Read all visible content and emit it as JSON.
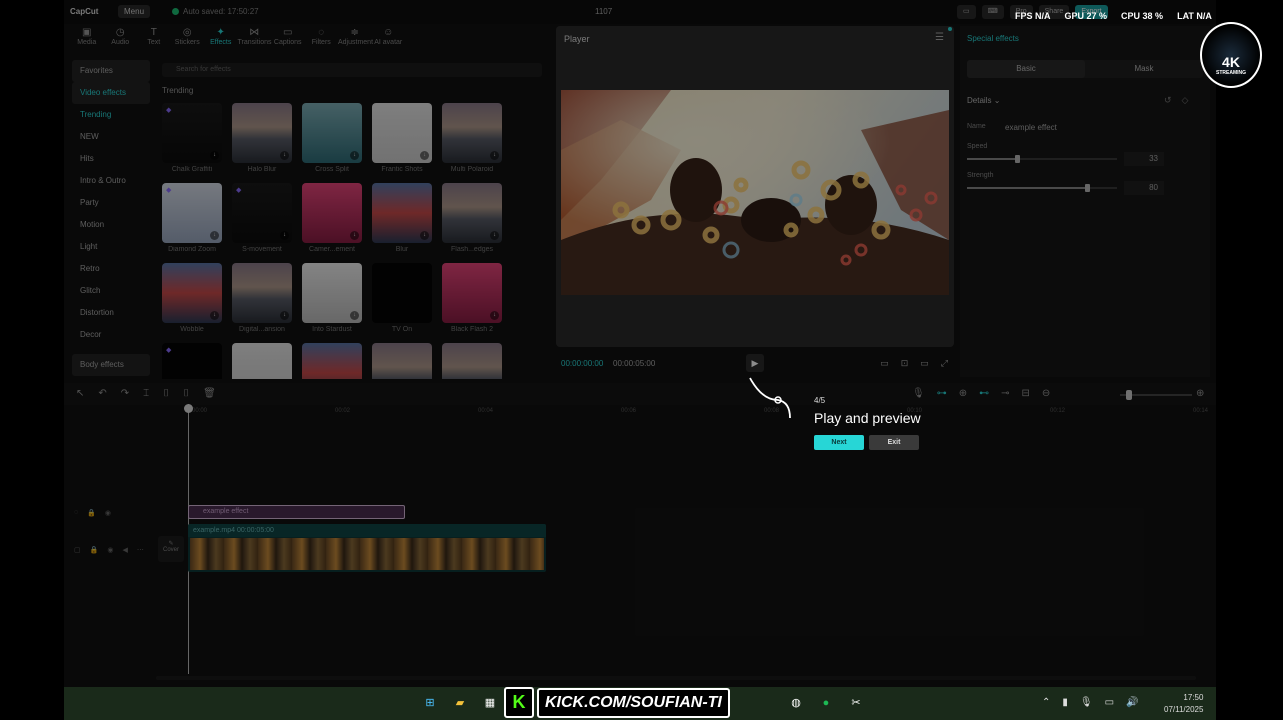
{
  "app": {
    "logo": "CapCut",
    "menu": "Menu",
    "autosave": "Auto saved: 17:50:27",
    "project": "1107",
    "top_buttons": [
      "Pro",
      "Share",
      "Export"
    ]
  },
  "tools": [
    {
      "label": "Media",
      "icon": "media-icon",
      "glyph": "▣"
    },
    {
      "label": "Audio",
      "icon": "audio-icon",
      "glyph": "◷"
    },
    {
      "label": "Text",
      "icon": "text-icon",
      "glyph": "T"
    },
    {
      "label": "Stickers",
      "icon": "stickers-icon",
      "glyph": "◎"
    },
    {
      "label": "Effects",
      "icon": "effects-icon",
      "glyph": "✦"
    },
    {
      "label": "Transitions",
      "icon": "transitions-icon",
      "glyph": "⋈"
    },
    {
      "label": "Captions",
      "icon": "captions-icon",
      "glyph": "▭"
    },
    {
      "label": "Filters",
      "icon": "filters-icon",
      "glyph": "◌"
    },
    {
      "label": "Adjustment",
      "icon": "adjustment-icon",
      "glyph": "≑"
    },
    {
      "label": "AI avatar",
      "icon": "ai-avatar-icon",
      "glyph": "☺"
    }
  ],
  "categories": [
    "Favorites",
    "Video effects",
    "Trending",
    "NEW",
    "Hits",
    "Intro & Outro",
    "Party",
    "Motion",
    "Light",
    "Retro",
    "Glitch",
    "Distortion",
    "Decor",
    "Body effects"
  ],
  "search": {
    "placeholder": "Search for effects"
  },
  "section_title": "Trending",
  "effects": [
    {
      "label": "Chalk Graffiti",
      "style": "t-dark"
    },
    {
      "label": "Halo Blur",
      "style": "t-city"
    },
    {
      "label": "Cross Split",
      "style": "t-teal"
    },
    {
      "label": "Frantic Shots",
      "style": "t-white"
    },
    {
      "label": "Multi Polaroid",
      "style": "t-city"
    },
    {
      "label": "Diamond Zoom",
      "style": "t-snow"
    },
    {
      "label": "S-movement",
      "style": "t-dark"
    },
    {
      "label": "Camer...ement",
      "style": "t-pink"
    },
    {
      "label": "Blur",
      "style": "t-red"
    },
    {
      "label": "Flash...edges",
      "style": "t-city"
    },
    {
      "label": "Wobble",
      "style": "t-red"
    },
    {
      "label": "Digital...ansion",
      "style": "t-city"
    },
    {
      "label": "Into Stardust",
      "style": "t-bw"
    },
    {
      "label": "TV On",
      "style": "t-black"
    },
    {
      "label": "Black Flash 2",
      "style": "t-pink"
    },
    {
      "label": "",
      "style": "t-black"
    },
    {
      "label": "",
      "style": "t-white"
    },
    {
      "label": "",
      "style": "t-red"
    },
    {
      "label": "",
      "style": "t-city"
    },
    {
      "label": "",
      "style": "t-city"
    }
  ],
  "player": {
    "title": "Player",
    "time_current": "00:00:00:00",
    "time_total": "00:00:05:00"
  },
  "right_panel": {
    "title": "Special effects",
    "tabs": [
      "Basic",
      "Mask"
    ],
    "details": "Details",
    "name_label": "Name",
    "name_value": "example effect",
    "speed_label": "Speed",
    "speed_value": "33",
    "strength_label": "Strength",
    "strength_value": "80"
  },
  "timeline": {
    "ruler": [
      "00:00",
      "00:02",
      "00:04",
      "00:06",
      "00:08",
      "00:10",
      "00:12",
      "00:14"
    ],
    "effect_clip": "example effect",
    "video_clip": "example.mp4  00:00:05:00",
    "cover": "Cover"
  },
  "guide": {
    "step": "4/5",
    "title": "Play and preview",
    "next": "Next",
    "exit": "Exit"
  },
  "stats": {
    "fps": "FPS N/A",
    "gpu": "GPU 27 %",
    "cpu": "CPU 38 %",
    "lat": "LAT N/A"
  },
  "badge": {
    "big": "4K",
    "small": "STREAMING"
  },
  "taskbar": {
    "kick_url": "KICK.COM/SOUFIAN-TI",
    "time": "17:50",
    "date": "07/11/2025"
  },
  "colors": {
    "accent": "#2bd6d6",
    "effect_clip": "#4b2f50",
    "video_clip": "#0d3a3a",
    "kick_green": "#53fc18"
  },
  "speed_fraction": 0.33,
  "strength_fraction": 0.8
}
